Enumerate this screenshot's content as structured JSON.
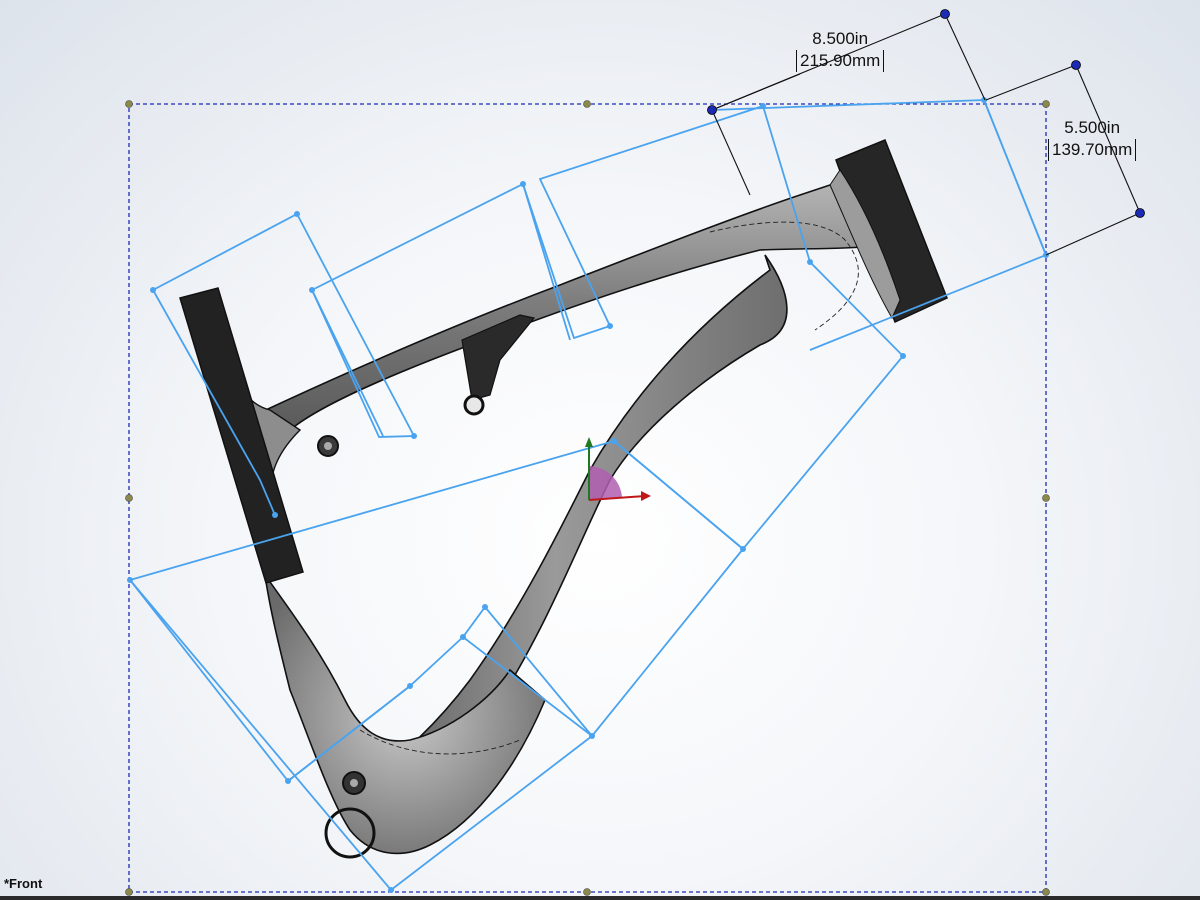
{
  "view": {
    "name": "*Front"
  },
  "dimensions": [
    {
      "primary": "8.500in",
      "secondary": "215.90mm"
    },
    {
      "primary": "5.500in",
      "secondary": "139.70mm"
    }
  ],
  "colors": {
    "sketch": "#4aa3ef",
    "bounding_box": "#1b2bb5",
    "frame_body": "#8a8a8a",
    "frame_dark": "#2a2a2a",
    "axis_x": "#c01818",
    "axis_y": "#1f7a1f",
    "background": "#e9edf2"
  },
  "icons": [
    "origin-triad-icon"
  ]
}
